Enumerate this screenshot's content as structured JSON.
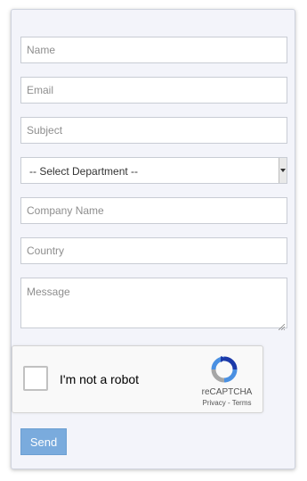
{
  "form": {
    "name_placeholder": "Name",
    "email_placeholder": "Email",
    "subject_placeholder": "Subject",
    "department_selected": "-- Select Department --",
    "company_placeholder": "Company Name",
    "country_placeholder": "Country",
    "message_placeholder": "Message",
    "send_label": "Send"
  },
  "captcha": {
    "label": "I'm not a robot",
    "brand": "reCAPTCHA",
    "links": "Privacy - Terms"
  },
  "colors": {
    "send_button": "#7aabdd",
    "panel_background": "#f3f4fa",
    "captcha_blue": "#4a90e2",
    "captcha_dark_blue": "#1c3aa9"
  }
}
